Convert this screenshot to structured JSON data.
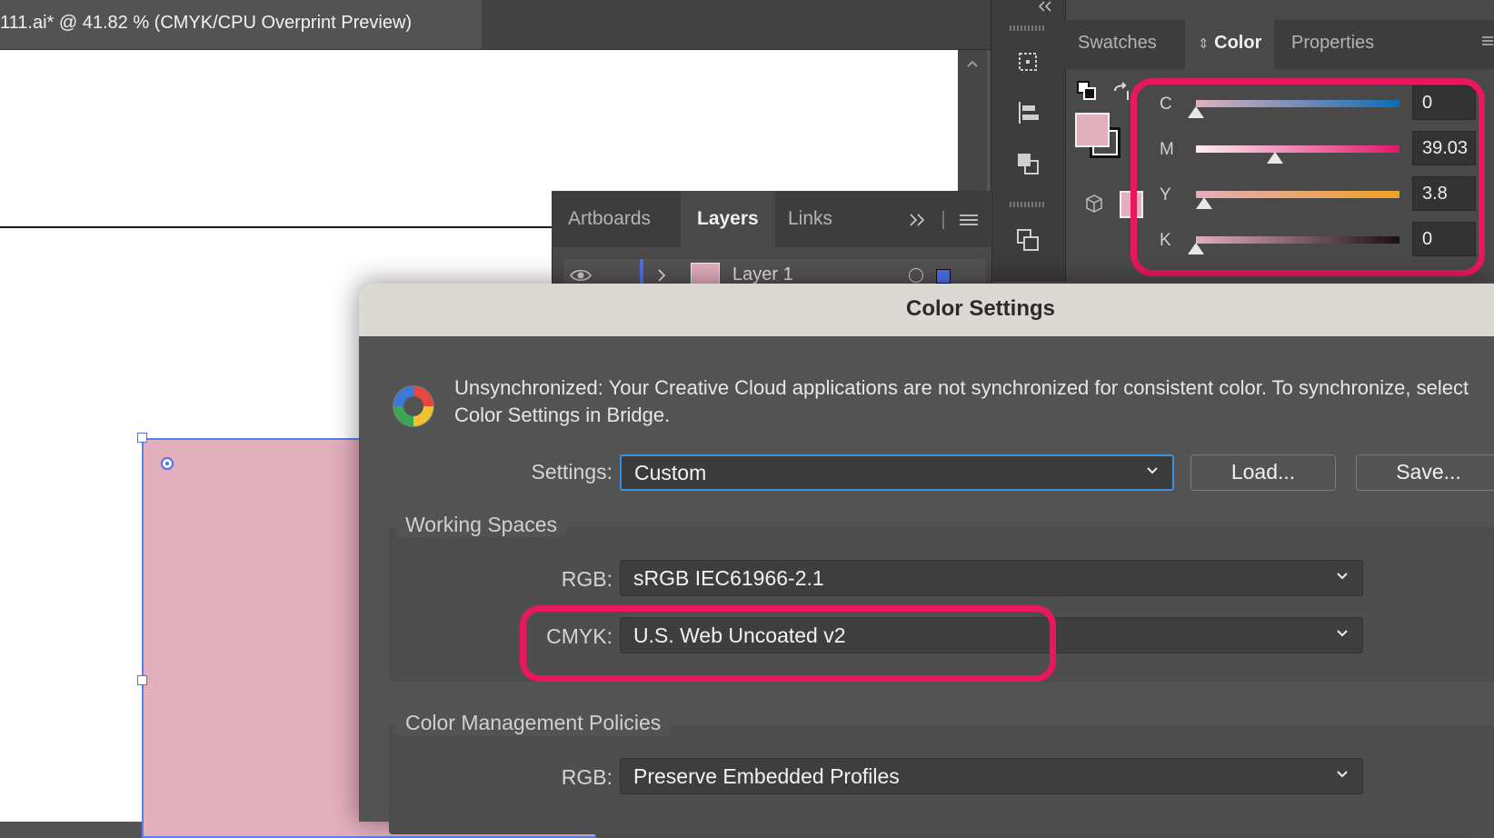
{
  "document": {
    "tab_title": "111.ai* @ 41.82 % (CMYK/CPU Overprint Preview)"
  },
  "color_panel": {
    "tabs": [
      "Swatches",
      "Color",
      "Properties"
    ],
    "active_tab": "Color",
    "fill_color": "#e2afbd",
    "sliders": [
      {
        "label": "C",
        "value": "0",
        "fraction": 0.0
      },
      {
        "label": "M",
        "value": "39.03",
        "fraction": 0.3903
      },
      {
        "label": "Y",
        "value": "3.8",
        "fraction": 0.038
      },
      {
        "label": "K",
        "value": "0",
        "fraction": 0.0
      }
    ],
    "highlight_color": "#e8175f"
  },
  "layers_panel": {
    "tabs": [
      "Artboards",
      "Layers",
      "Links"
    ],
    "active_tab": "Layers",
    "layer_name": "Layer 1"
  },
  "dialog": {
    "title": "Color Settings",
    "sync_message": "Unsynchronized: Your Creative Cloud applications are not synchronized for consistent color. To synchronize, select Color Settings in Bridge.",
    "settings_label": "Settings:",
    "settings_value": "Custom",
    "load_button": "Load...",
    "save_button": "Save...",
    "working_spaces": {
      "title": "Working Spaces",
      "rgb_label": "RGB:",
      "rgb_value": "sRGB IEC61966-2.1",
      "cmyk_label": "CMYK:",
      "cmyk_value": "U.S. Web Uncoated v2"
    },
    "policies": {
      "title": "Color Management Policies",
      "rgb_label": "RGB:",
      "rgb_value": "Preserve Embedded Profiles"
    }
  }
}
